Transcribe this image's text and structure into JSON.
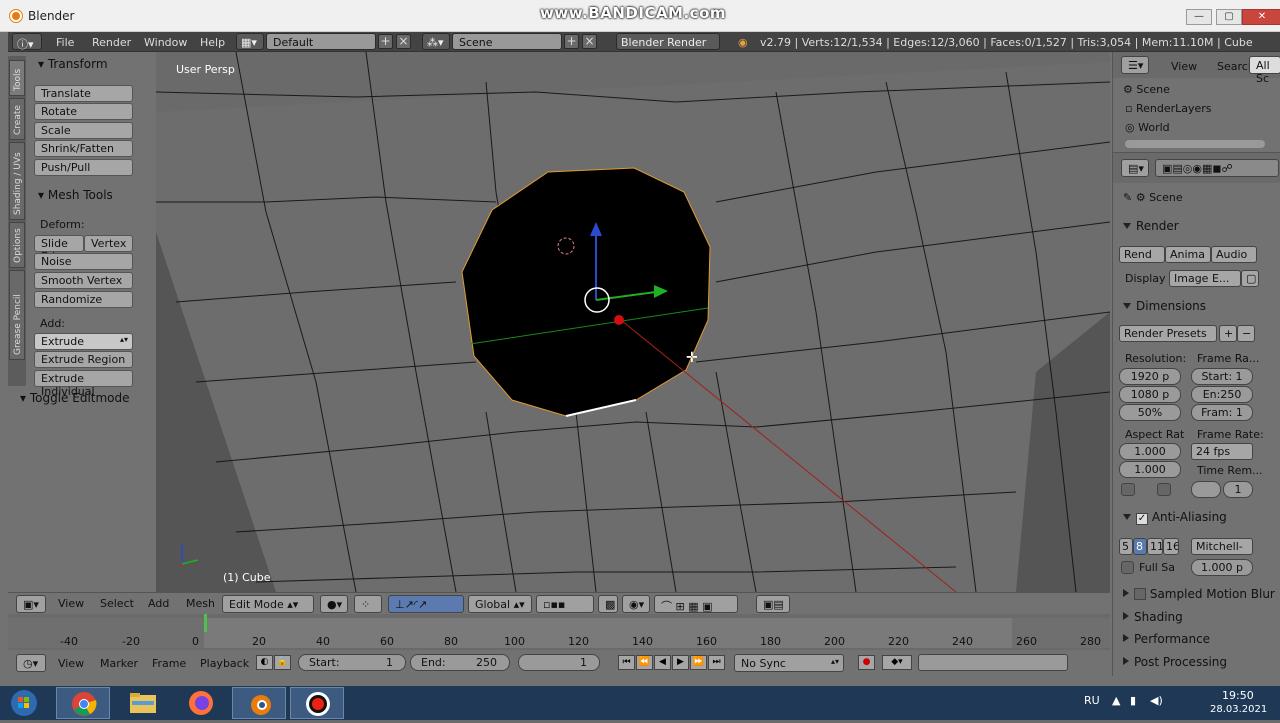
{
  "window": {
    "title": "Blender",
    "watermark": "www.BANDICAM.com",
    "btn_min": "—",
    "btn_max": "▢",
    "btn_close": "✕"
  },
  "menu": {
    "file": "File",
    "render": "Render",
    "window": "Window",
    "help": "Help",
    "layout": "Default",
    "scene": "Scene",
    "engine": "Blender Render",
    "stats": "v2.79 | Verts:12/1,534 | Edges:12/3,060 | Faces:0/1,527 | Tris:3,054 | Mem:11.10M | Cube"
  },
  "tabs": [
    "Tools",
    "Create",
    "Shading / UVs",
    "Options",
    "Grease Pencil"
  ],
  "toolshelf": {
    "transform_header": "Transform",
    "transform": [
      "Translate",
      "Rotate",
      "Scale",
      "Shrink/Fatten",
      "Push/Pull"
    ],
    "mesh_tools_header": "Mesh Tools",
    "deform_label": "Deform:",
    "slide_edge": "Slide Ed",
    "vertex": "Vertex",
    "deform": [
      "Noise",
      "Smooth Vertex",
      "Randomize"
    ],
    "add_label": "Add:",
    "extrude": "Extrude",
    "add": [
      "Extrude Region",
      "Extrude Individual"
    ],
    "toggle_editmode": "Toggle Editmode"
  },
  "viewport": {
    "view_name": "User Persp",
    "object": "(1) Cube"
  },
  "header3d": {
    "view": "View",
    "select": "Select",
    "add": "Add",
    "mesh": "Mesh",
    "mode": "Edit Mode",
    "orientation": "Global"
  },
  "timeline": {
    "ticks": [
      "-40",
      "-20",
      "0",
      "20",
      "40",
      "60",
      "80",
      "100",
      "120",
      "140",
      "160",
      "180",
      "200",
      "220",
      "240",
      "260",
      "280"
    ],
    "view": "View",
    "marker": "Marker",
    "frame": "Frame",
    "playback": "Playback",
    "start_label": "Start:",
    "start": "1",
    "end_label": "End:",
    "end": "250",
    "current": "1",
    "sync": "No Sync"
  },
  "outliner": {
    "view": "View",
    "search": "Search",
    "filter": "All Sc",
    "items": [
      "Scene",
      "RenderLayers",
      "World"
    ]
  },
  "properties": {
    "context": "Scene",
    "render": "Render",
    "render_btns": [
      "Rend",
      "Anima",
      "Audio"
    ],
    "display_label": "Display",
    "display": "Image E...",
    "dimensions": "Dimensions",
    "presets": "Render Presets",
    "resolution_label": "Resolution:",
    "res_x": "1920 p",
    "res_y": "1080 p",
    "res_pct": "50%",
    "frame_range_label": "Frame Ra...",
    "frame_start": "Start: 1",
    "frame_end": "En:250",
    "frame_step": "Fram: 1",
    "aspect_label": "Aspect Rat",
    "aspect_x": "1.000",
    "aspect_y": "1.000",
    "frame_rate_label": "Frame Rate:",
    "fps": "24 fps",
    "time_remap": "Time Rem...",
    "remap_val": "1",
    "aa": "Anti-Aliasing",
    "aa_samples": [
      "5",
      "8",
      "11",
      "16"
    ],
    "aa_filter": "Mitchell-",
    "full_sample": "Full Sa",
    "filter_size": "1.000 p",
    "sampled_motion": "Sampled Motion Blur",
    "shading": "Shading",
    "performance": "Performance",
    "post_processing": "Post Processing"
  },
  "taskbar": {
    "lang": "RU",
    "time": "19:50",
    "date": "28.03.2021"
  }
}
